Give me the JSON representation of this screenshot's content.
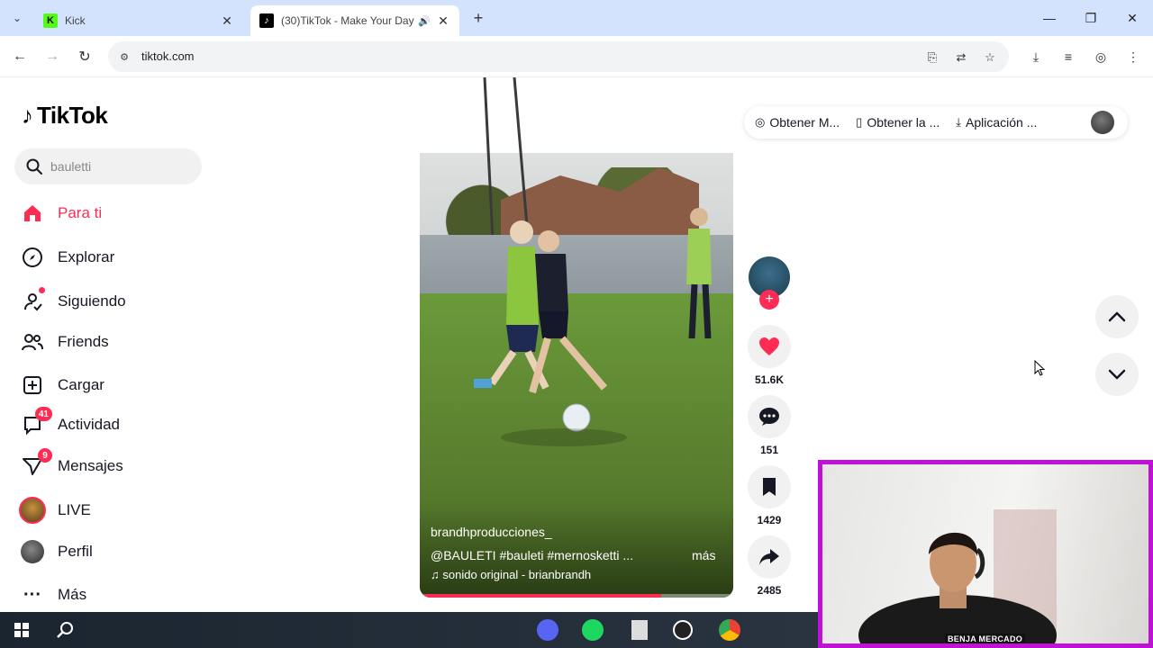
{
  "browser": {
    "tabs": [
      {
        "title": "Kick",
        "active": false
      },
      {
        "title": "(30)TikTok - Make Your Day",
        "active": true
      }
    ],
    "url": "tiktok.com"
  },
  "tiktok": {
    "logo": "TikTok",
    "search": {
      "value": "bauletti"
    },
    "nav": [
      {
        "label": "Para ti",
        "icon": "home-icon",
        "active": true
      },
      {
        "label": "Explorar",
        "icon": "compass-icon"
      },
      {
        "label": "Siguiendo",
        "icon": "following-icon"
      },
      {
        "label": "Friends",
        "icon": "friends-icon"
      },
      {
        "label": "Cargar",
        "icon": "upload-icon"
      },
      {
        "label": "Actividad",
        "icon": "activity-icon",
        "badge": "41"
      },
      {
        "label": "Mensajes",
        "icon": "messages-icon",
        "badge": "9"
      },
      {
        "label": "LIVE",
        "icon": "live-icon"
      },
      {
        "label": "Perfil",
        "icon": "profile-icon"
      },
      {
        "label": "Más",
        "icon": "more-icon"
      }
    ],
    "toplinks": [
      {
        "label": "Obtener M...",
        "icon": "coin-icon"
      },
      {
        "label": "Obtener la ...",
        "icon": "phone-icon"
      },
      {
        "label": "Aplicación ...",
        "icon": "download-icon"
      }
    ],
    "video": {
      "author": "brandhproducciones_",
      "description": "@BAULETI #bauleti #mernosketti ...",
      "more": "más",
      "music": "sonido original - brianbrandh",
      "progress": 0.77
    },
    "actions": {
      "likes": "51.6K",
      "comments": "151",
      "saves": "1429",
      "shares": "2485"
    }
  },
  "webcam": {
    "name": "BENJA MERCADO"
  },
  "colors": {
    "accent": "#fe2c55",
    "webcam_border": "#c012d6",
    "tab_strip": "#d3e3fd"
  }
}
